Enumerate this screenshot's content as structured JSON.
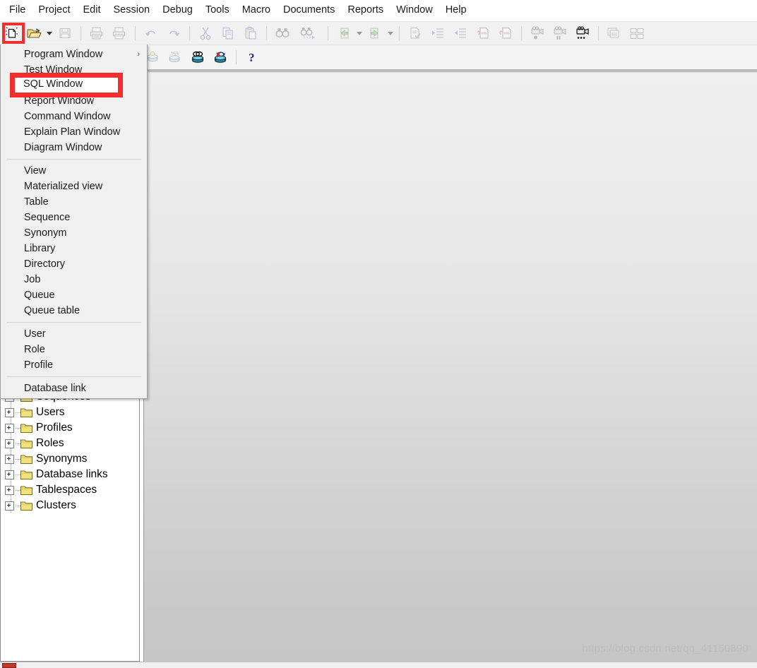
{
  "app": {
    "watermark": "https://blog.csdn.net/qq_41150890"
  },
  "menubar": {
    "items": [
      {
        "label": "File"
      },
      {
        "label": "Project"
      },
      {
        "label": "Edit"
      },
      {
        "label": "Session"
      },
      {
        "label": "Debug"
      },
      {
        "label": "Tools"
      },
      {
        "label": "Macro"
      },
      {
        "label": "Documents"
      },
      {
        "label": "Reports"
      },
      {
        "label": "Window"
      },
      {
        "label": "Help"
      }
    ]
  },
  "toolbar1": {
    "buttons": [
      {
        "name": "new-button",
        "icon": "new-document-icon",
        "enabled": true
      },
      {
        "name": "open-button",
        "icon": "open-folder-icon",
        "enabled": true
      },
      {
        "name": "open-dropdown",
        "icon": "chevron-down-icon",
        "enabled": true
      },
      {
        "name": "save-button",
        "icon": "save-disk-icon",
        "enabled": false
      },
      {
        "name": "print-button",
        "icon": "print-icon",
        "enabled": false
      },
      {
        "name": "print-preview-button",
        "icon": "print-preview-icon",
        "enabled": false
      },
      {
        "name": "undo-button",
        "icon": "undo-arrow-icon",
        "enabled": false
      },
      {
        "name": "redo-button",
        "icon": "redo-arrow-icon",
        "enabled": false
      },
      {
        "name": "cut-button",
        "icon": "scissors-icon",
        "enabled": false
      },
      {
        "name": "copy-button",
        "icon": "copy-icon",
        "enabled": false
      },
      {
        "name": "paste-button",
        "icon": "clipboard-paste-icon",
        "enabled": false
      },
      {
        "name": "find-button",
        "icon": "binoculars-icon",
        "enabled": false
      },
      {
        "name": "find-next-button",
        "icon": "binoculars-next-icon",
        "enabled": false
      },
      {
        "name": "previous-button",
        "icon": "green-back-arrow-icon",
        "enabled": false
      },
      {
        "name": "previous-dropdown",
        "icon": "chevron-down-icon",
        "enabled": false
      },
      {
        "name": "next-button",
        "icon": "green-forward-arrow-icon",
        "enabled": false
      },
      {
        "name": "next-dropdown",
        "icon": "chevron-down-icon",
        "enabled": false
      },
      {
        "name": "check-syntax-button",
        "icon": "document-check-icon",
        "enabled": false
      },
      {
        "name": "indent-button",
        "icon": "indent-icon",
        "enabled": false
      },
      {
        "name": "outdent-button",
        "icon": "outdent-icon",
        "enabled": false
      },
      {
        "name": "comment-button",
        "icon": "comment-document-icon",
        "enabled": false
      },
      {
        "name": "uncomment-button",
        "icon": "uncomment-document-icon",
        "enabled": false
      },
      {
        "name": "record-macro-button",
        "icon": "camera-record-icon",
        "enabled": false
      },
      {
        "name": "pause-macro-button",
        "icon": "camera-pause-icon",
        "enabled": false
      },
      {
        "name": "macro-options-button",
        "icon": "camera-options-icon",
        "enabled": true
      },
      {
        "name": "cascade-windows-button",
        "icon": "cascade-windows-icon",
        "enabled": false
      },
      {
        "name": "tile-windows-button",
        "icon": "tile-windows-icon",
        "enabled": false
      }
    ]
  },
  "toolbar2": {
    "buttons": [
      {
        "name": "session-logon-button",
        "icon": "database-key-icon",
        "enabled": false
      },
      {
        "name": "session-sql-button",
        "icon": "database-sql-icon",
        "enabled": false
      },
      {
        "name": "commit-button",
        "icon": "database-commit-icon",
        "enabled": true
      },
      {
        "name": "rollback-button",
        "icon": "database-rollback-icon",
        "enabled": true
      },
      {
        "name": "help-button",
        "icon": "question-mark-icon",
        "enabled": true
      }
    ]
  },
  "new_menu": {
    "groups": [
      [
        {
          "label": "Program Window",
          "has_submenu": true
        },
        {
          "label": "Test Window",
          "has_submenu": false
        },
        {
          "label": "SQL Window",
          "has_submenu": false,
          "highlighted": true
        },
        {
          "label": "Report Window",
          "has_submenu": false
        },
        {
          "label": "Command Window",
          "has_submenu": false
        },
        {
          "label": "Explain Plan Window",
          "has_submenu": false
        },
        {
          "label": "Diagram Window",
          "has_submenu": false
        }
      ],
      [
        {
          "label": "View",
          "has_submenu": false
        },
        {
          "label": "Materialized view",
          "has_submenu": false
        },
        {
          "label": "Table",
          "has_submenu": false
        },
        {
          "label": "Sequence",
          "has_submenu": false
        },
        {
          "label": "Synonym",
          "has_submenu": false
        },
        {
          "label": "Library",
          "has_submenu": false
        },
        {
          "label": "Directory",
          "has_submenu": false
        },
        {
          "label": "Job",
          "has_submenu": false
        },
        {
          "label": "Queue",
          "has_submenu": false
        },
        {
          "label": "Queue table",
          "has_submenu": false
        }
      ],
      [
        {
          "label": "User",
          "has_submenu": false
        },
        {
          "label": "Role",
          "has_submenu": false
        },
        {
          "label": "Profile",
          "has_submenu": false
        }
      ],
      [
        {
          "label": "Database link",
          "has_submenu": false
        }
      ]
    ],
    "submenu_arrow": "›",
    "highlight_color": "#f22e2e"
  },
  "tree": {
    "items": [
      {
        "label": "Sequences",
        "icon": "folder-icon",
        "expandable": true
      },
      {
        "label": "Users",
        "icon": "folder-icon",
        "expandable": true
      },
      {
        "label": "Profiles",
        "icon": "folder-icon",
        "expandable": true
      },
      {
        "label": "Roles",
        "icon": "folder-icon",
        "expandable": true
      },
      {
        "label": "Synonyms",
        "icon": "folder-icon",
        "expandable": true
      },
      {
        "label": "Database links",
        "icon": "folder-icon",
        "expandable": true
      },
      {
        "label": "Tablespaces",
        "icon": "folder-icon",
        "expandable": true
      },
      {
        "label": "Clusters",
        "icon": "folder-icon",
        "expandable": true
      }
    ]
  }
}
